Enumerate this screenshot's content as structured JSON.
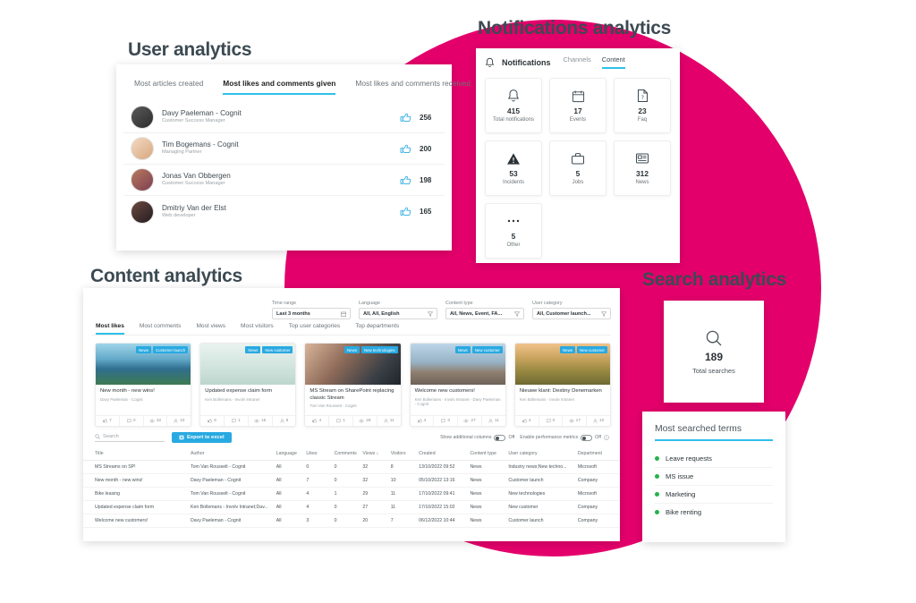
{
  "sections": {
    "user": "User analytics",
    "notifications": "Notifications analytics",
    "content": "Content analytics",
    "search": "Search analytics"
  },
  "colors": {
    "accent_pink": "#e4006b",
    "accent_blue": "#29a9e1",
    "tab_underline": "#2ec0ea",
    "bullet_green": "#24b24c"
  },
  "user_analytics": {
    "tabs": [
      {
        "label": "Most articles created",
        "active": false
      },
      {
        "label": "Most likes and comments given",
        "active": true
      },
      {
        "label": "Most likes and comments received",
        "active": false
      }
    ],
    "rows": [
      {
        "name": "Davy Paeleman - Cognit",
        "role": "Customer Success Manager",
        "count": "256"
      },
      {
        "name": "Tim Bogemans - Cognit",
        "role": "Managing Partner",
        "count": "200"
      },
      {
        "name": "Jonas Van Obbergen",
        "role": "Customer Success Manager",
        "count": "198"
      },
      {
        "name": "Dmitriy Van der Elst",
        "role": "Web developer",
        "count": "165"
      }
    ]
  },
  "notifications": {
    "title": "Notifications",
    "tabs": [
      {
        "label": "Channels",
        "active": false
      },
      {
        "label": "Content",
        "active": true
      }
    ],
    "cards": [
      {
        "icon": "bell-icon",
        "value": "415",
        "label": "Total notifications"
      },
      {
        "icon": "calendar-icon",
        "value": "17",
        "label": "Events"
      },
      {
        "icon": "faq-icon",
        "value": "23",
        "label": "Faq"
      },
      {
        "icon": "warning-icon",
        "value": "53",
        "label": "Incidents"
      },
      {
        "icon": "briefcase-icon",
        "value": "5",
        "label": "Jobs"
      },
      {
        "icon": "news-icon",
        "value": "312",
        "label": "News"
      },
      {
        "icon": "ellipsis-icon",
        "value": "5",
        "label": "Other"
      }
    ]
  },
  "content_analytics": {
    "filters": [
      {
        "label": "Time range",
        "value": "Last 3 months",
        "icon": "calendar-icon"
      },
      {
        "label": "Language",
        "value": "All, All, English",
        "icon": "funnel-icon"
      },
      {
        "label": "Content type",
        "value": "All, News, Event, FA...",
        "icon": "funnel-icon"
      },
      {
        "label": "User category",
        "value": "All, Customer launch...",
        "icon": "funnel-icon"
      }
    ],
    "tabs": [
      {
        "label": "Most likes",
        "active": true
      },
      {
        "label": "Most comments",
        "active": false
      },
      {
        "label": "Most views",
        "active": false
      },
      {
        "label": "Most visitors",
        "active": false
      },
      {
        "label": "Top user categories",
        "active": false
      },
      {
        "label": "Top departments",
        "active": false
      }
    ],
    "cards": [
      {
        "title": "New month - new wins!",
        "author": "Davy Paeleman - Cognit",
        "tags": [
          "News",
          "Customer launch"
        ],
        "likes": "7",
        "comments": "0",
        "views": "32",
        "visitors": "10",
        "image": "coastline-photo"
      },
      {
        "title": "Updated expense claim form",
        "author": "Ken Bollemans - Involv Intranet",
        "tags": [
          "News",
          "New customer"
        ],
        "likes": "6",
        "comments": "1",
        "views": "16",
        "visitors": "8",
        "image": "piggybanks-photo"
      },
      {
        "title": "MS Stream on SharePoint replacing classic Stream",
        "author": "Tom Van Roussett - Cognit",
        "tags": [
          "News",
          "New technologies"
        ],
        "likes": "4",
        "comments": "1",
        "views": "29",
        "visitors": "11",
        "image": "video-recording-photo"
      },
      {
        "title": "Welcome new customers!",
        "author": "Ken Bollemans - Involv Intranet - Davy Paeleman - Cognit",
        "tags": [
          "News",
          "New customer"
        ],
        "likes": "4",
        "comments": "0",
        "views": "27",
        "visitors": "11",
        "image": "church-square-photo"
      },
      {
        "title": "Nieuwe klant: Destiny Denemarken",
        "author": "Ken Bollemans - Involv Intranet",
        "tags": [
          "News",
          "New customer"
        ],
        "likes": "4",
        "comments": "0",
        "views": "17",
        "visitors": "10",
        "image": "wheat-field-photo"
      }
    ],
    "toolbar": {
      "search_placeholder": "Search",
      "export_label": "Export to excel",
      "show_columns_label": "Show additional columns",
      "show_columns_state": "Off",
      "performance_label": "Enable performance metrics",
      "performance_state": "Off"
    },
    "table": {
      "headers": [
        "Title",
        "Author",
        "Language",
        "Likes",
        "Comments",
        "Views ↓",
        "Visitors",
        "Created",
        "Content type",
        "User category",
        "Department"
      ],
      "rows": [
        [
          "MS Streams on SP!",
          "Tom Van Rousselt - Cognit",
          "All",
          "0",
          "0",
          "32",
          "8",
          "13/10/2022 09:52",
          "News",
          "Industry news;New techno...",
          "Microsoft"
        ],
        [
          "New month - new wins!",
          "Davy Paeleman - Cognit",
          "All",
          "7",
          "0",
          "32",
          "10",
          "05/10/2022 13:16",
          "News",
          "Customer launch",
          "Company"
        ],
        [
          "Bike leasing",
          "Tom Van Rousselt - Cognit",
          "All",
          "4",
          "1",
          "29",
          "11",
          "17/10/2022 09:41",
          "News",
          "New technologies",
          "Microsoft"
        ],
        [
          "Updated expense claim form",
          "Ken Bollemans - Involv Intranet;Dav...",
          "All",
          "4",
          "0",
          "27",
          "11",
          "17/10/2022 15:02",
          "News",
          "New customer",
          "Company"
        ],
        [
          "Welcome new customers!",
          "Davy Paeleman - Cognit",
          "All",
          "3",
          "0",
          "20",
          "7",
          "06/12/2022 10:44",
          "News",
          "Customer launch",
          "Company"
        ]
      ]
    }
  },
  "search_analytics": {
    "total": {
      "icon": "search-icon",
      "value": "189",
      "label": "Total searches"
    },
    "terms_title": "Most searched terms",
    "terms": [
      "Leave requests",
      "MS issue",
      "Marketing",
      "Bike renting"
    ]
  }
}
